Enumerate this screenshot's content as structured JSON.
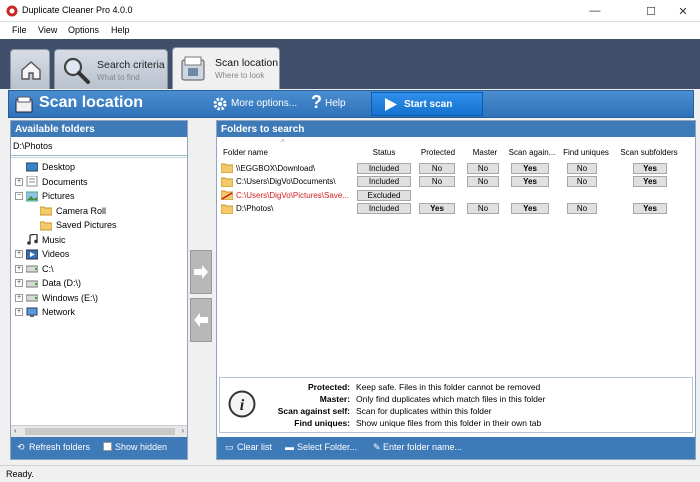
{
  "window": {
    "title": "Duplicate Cleaner Pro 4.0.0",
    "controls": [
      "—",
      "☐",
      "✕"
    ]
  },
  "menu": [
    "File",
    "View",
    "Options",
    "Help"
  ],
  "tabs": [
    {
      "label": "",
      "sub": ""
    },
    {
      "label": "Search criteria",
      "sub": "What to find"
    },
    {
      "label": "Scan location",
      "sub": "Where to look"
    }
  ],
  "header": {
    "title": "Scan location",
    "more_options": "More options...",
    "help": "Help",
    "start_scan": "Start scan"
  },
  "left": {
    "heading": "Available folders",
    "path_value": "D:\\Photos",
    "tree": [
      {
        "label": "Desktop",
        "icon": "desktop-icon",
        "depth": 0,
        "expander": ""
      },
      {
        "label": "Documents",
        "icon": "documents-icon",
        "depth": 0,
        "expander": "+"
      },
      {
        "label": "Pictures",
        "icon": "pictures-icon",
        "depth": 0,
        "expander": "−"
      },
      {
        "label": "Camera Roll",
        "icon": "folder-icon",
        "depth": 1,
        "expander": ""
      },
      {
        "label": "Saved Pictures",
        "icon": "folder-icon",
        "depth": 1,
        "expander": ""
      },
      {
        "label": "Music",
        "icon": "music-icon",
        "depth": 0,
        "expander": ""
      },
      {
        "label": "Videos",
        "icon": "videos-icon",
        "depth": 0,
        "expander": "+"
      },
      {
        "label": "C:\\",
        "icon": "drive-icon",
        "depth": 0,
        "expander": "+"
      },
      {
        "label": "Data (D:\\)",
        "icon": "drive-icon",
        "depth": 0,
        "expander": "+"
      },
      {
        "label": "Windows (E:\\)",
        "icon": "drive-icon",
        "depth": 0,
        "expander": "+"
      },
      {
        "label": "Network",
        "icon": "network-icon",
        "depth": 0,
        "expander": "+"
      }
    ],
    "refresh": "Refresh folders",
    "show_hidden": "Show hidden"
  },
  "right": {
    "heading": "Folders to search",
    "columns": [
      "Folder name",
      "Status",
      "Protected",
      "Master",
      "Scan again...",
      "Find uniques",
      "Scan subfolders"
    ],
    "rows": [
      {
        "name": "\\\\EGGBOX\\Download\\",
        "status": "Included",
        "protected": "No",
        "master": "No",
        "scan_against": "Yes",
        "find_uniques": "No",
        "scan_subfolders": "Yes",
        "excluded": false
      },
      {
        "name": "C:\\Users\\DigVo\\Documents\\",
        "status": "Included",
        "protected": "No",
        "master": "No",
        "scan_against": "Yes",
        "find_uniques": "No",
        "scan_subfolders": "Yes",
        "excluded": false
      },
      {
        "name": "C:\\Users\\DigVo\\Pictures\\Save...",
        "status": "Excluded",
        "protected": "",
        "master": "",
        "scan_against": "",
        "find_uniques": "",
        "scan_subfolders": "",
        "excluded": true
      },
      {
        "name": "D:\\Photos\\",
        "status": "Included",
        "protected": "Yes",
        "master": "No",
        "scan_against": "Yes",
        "find_uniques": "No",
        "scan_subfolders": "Yes",
        "excluded": false
      }
    ],
    "info": [
      {
        "key": "Protected:",
        "value": "Keep safe. Files in this folder cannot be removed"
      },
      {
        "key": "Master:",
        "value": "Only find duplicates which match files in this folder"
      },
      {
        "key": "Scan against self:",
        "value": "Scan for duplicates within this folder"
      },
      {
        "key": "Find uniques:",
        "value": "Show unique files from this folder in their own tab"
      }
    ],
    "clear_list": "Clear list",
    "select_folder": "Select Folder...",
    "enter_folder": "Enter folder name..."
  },
  "status": "Ready.",
  "colors": {
    "header_blue": "#3e79b8",
    "tab_bg": "#40506a",
    "excluded_red": "#d02020"
  }
}
